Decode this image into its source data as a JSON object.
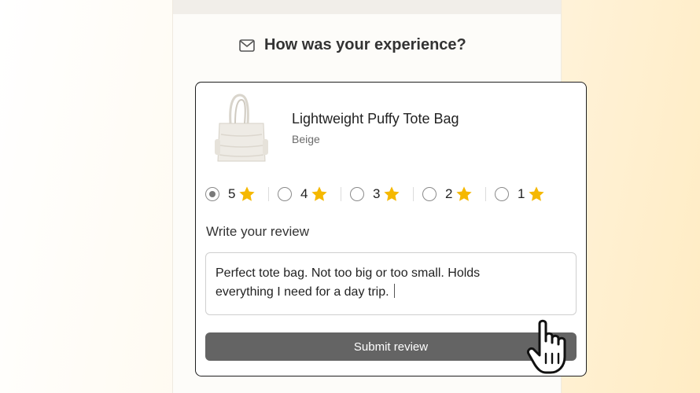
{
  "email": {
    "heading": "How was your experience?",
    "heading_icon": "envelope-icon"
  },
  "product": {
    "name": "Lightweight Puffy Tote Bag",
    "variant": "Beige",
    "image_icon": "tote-bag-image"
  },
  "rating": {
    "options": [
      {
        "value": "5",
        "selected": true
      },
      {
        "value": "4",
        "selected": false
      },
      {
        "value": "3",
        "selected": false
      },
      {
        "value": "2",
        "selected": false
      },
      {
        "value": "1",
        "selected": false
      }
    ],
    "star_color": "#f5b800"
  },
  "review": {
    "label": "Write your review",
    "line1": "Perfect tote bag. Not too big or too small. Holds",
    "line2": "everything I need for a day trip."
  },
  "submit": {
    "label": "Submit review",
    "color": "#646464"
  },
  "cursor_icon": "hand-pointer-icon"
}
